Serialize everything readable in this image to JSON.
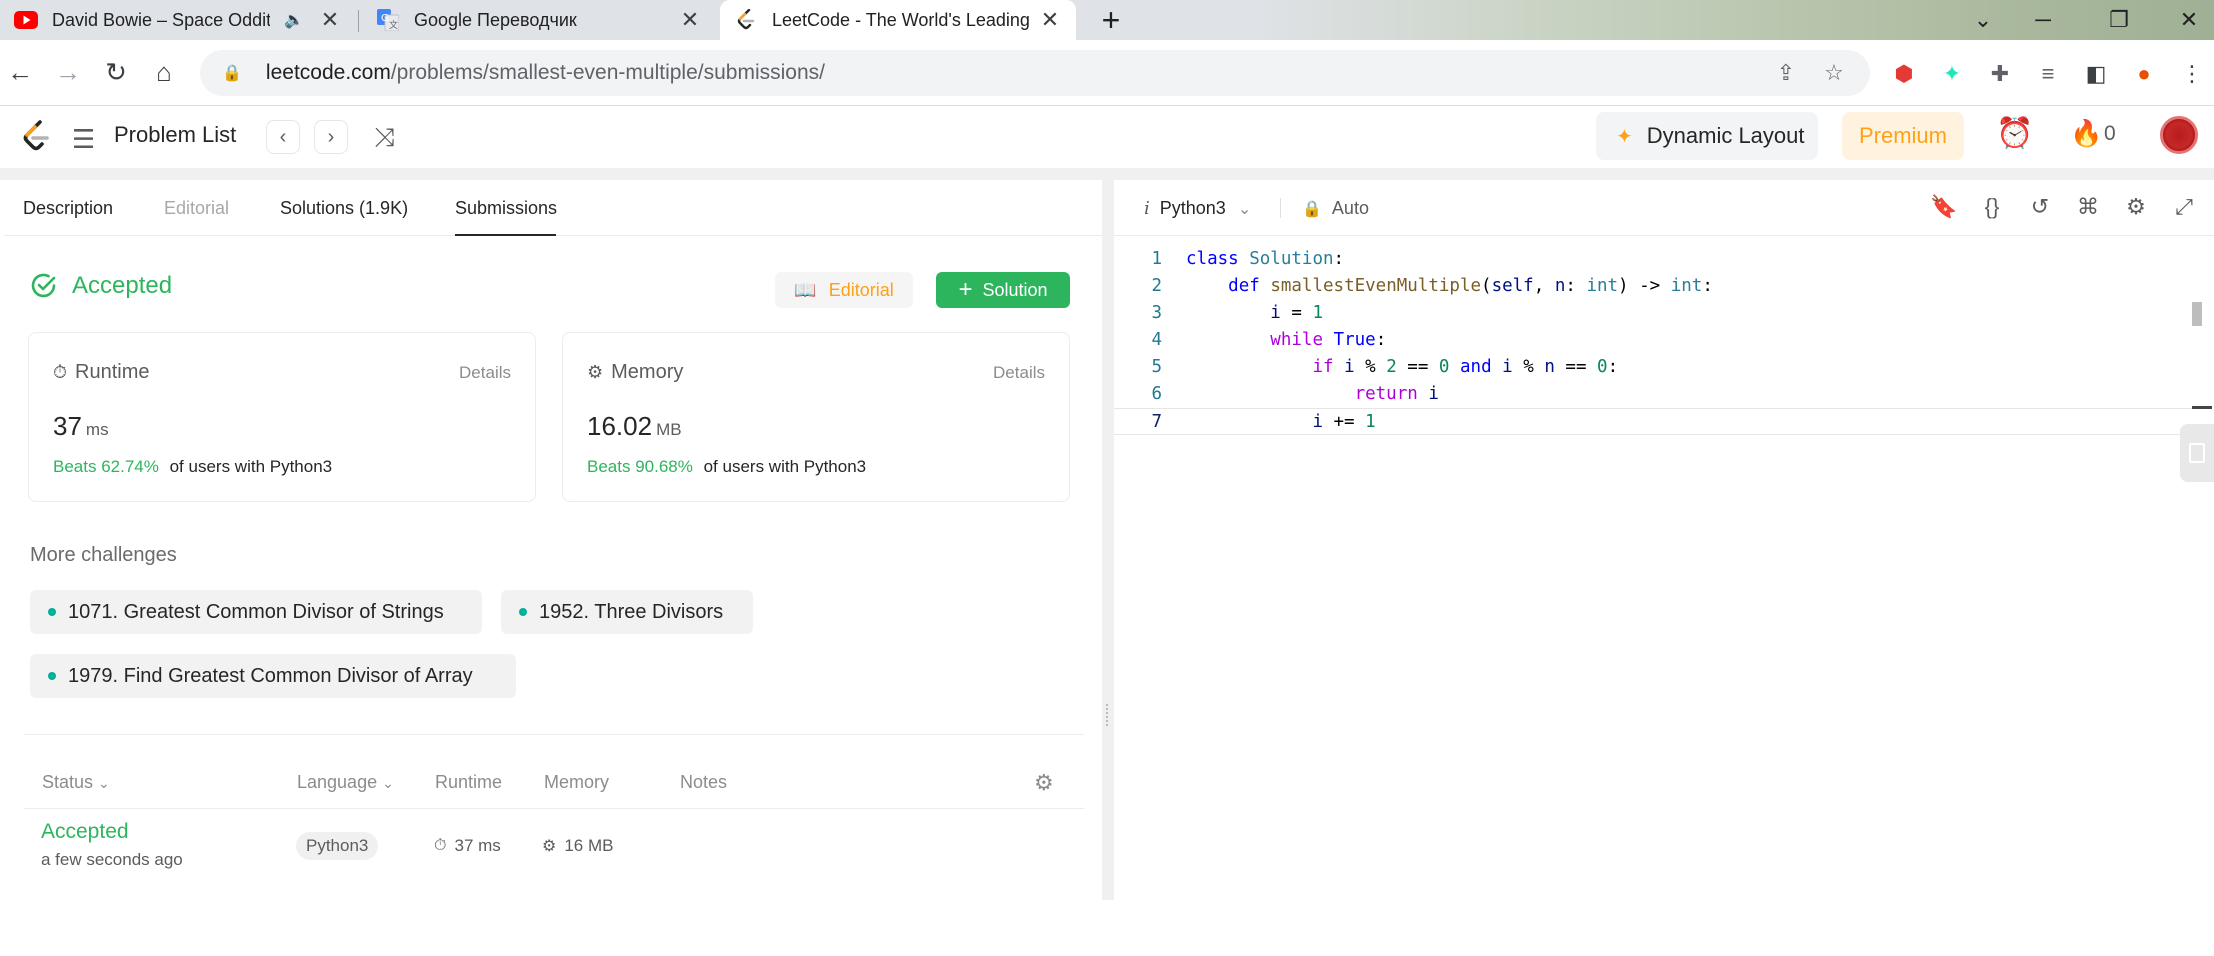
{
  "browser": {
    "tabs": [
      {
        "title": "David Bowie – Space Oddity",
        "icon": "youtube-icon",
        "audio": true
      },
      {
        "title": "Google Переводчик",
        "icon": "google-translate-icon"
      },
      {
        "title": "LeetCode - The World's Leading",
        "icon": "leetcode-icon",
        "active": true
      }
    ],
    "url_host": "leetcode.com",
    "url_path": "/problems/smallest-even-multiple/submissions/"
  },
  "header": {
    "problem_list": "Problem List",
    "dynamic_layout": "Dynamic Layout",
    "premium": "Premium",
    "streak_count": "0"
  },
  "left": {
    "tabs": [
      "Description",
      "Editorial",
      "Solutions (1.9K)",
      "Submissions"
    ],
    "active_tab": "Submissions",
    "status": "Accepted",
    "editorial_btn": "Editorial",
    "solution_btn": "Solution",
    "runtime": {
      "label": "Runtime",
      "details": "Details",
      "value": "37",
      "unit": "ms",
      "beats": "Beats 62.74%",
      "suffix": "of users with Python3"
    },
    "memory": {
      "label": "Memory",
      "details": "Details",
      "value": "16.02",
      "unit": "MB",
      "beats": "Beats 90.68%",
      "suffix": "of users with Python3"
    },
    "more_title": "More challenges",
    "challenges": [
      "1071. Greatest Common Divisor of Strings",
      "1952. Three Divisors",
      "1979. Find Greatest Common Divisor of Array"
    ],
    "table": {
      "headers": [
        "Status",
        "Language",
        "Runtime",
        "Memory",
        "Notes"
      ],
      "rows": [
        {
          "status": "Accepted",
          "time": "a few seconds ago",
          "language": "Python3",
          "runtime": "37 ms",
          "memory": "16 MB"
        }
      ]
    }
  },
  "editor": {
    "language": "Python3",
    "mode": "Auto",
    "code_lines": [
      "class Solution:",
      "    def smallestEvenMultiple(self, n: int) -> int:",
      "        i = 1",
      "        while True:",
      "            if i % 2 == 0 and i % n == 0:",
      "                return i",
      "            i += 1"
    ],
    "line_numbers": [
      "1",
      "2",
      "3",
      "4",
      "5",
      "6",
      "7"
    ]
  },
  "colors": {
    "accent": "#ffa116",
    "success": "#2db55d",
    "teal": "#00af9b"
  }
}
